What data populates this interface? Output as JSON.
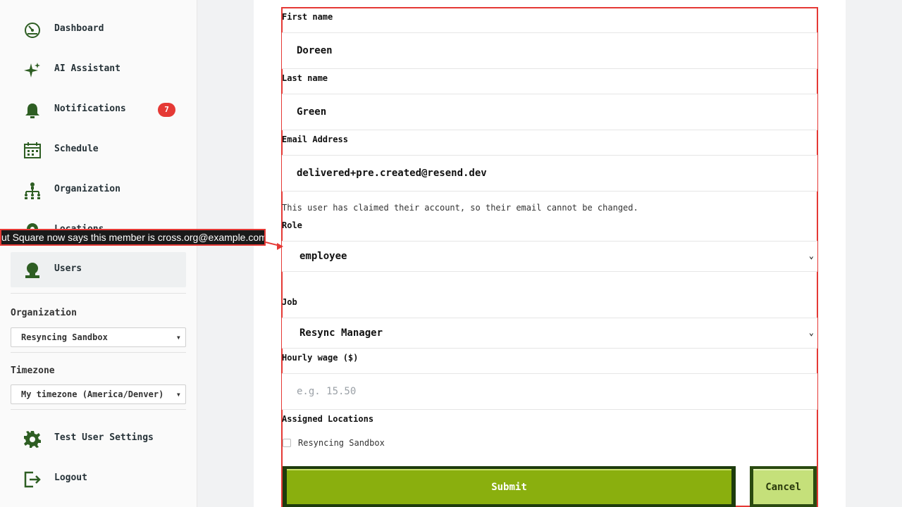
{
  "sidebar": {
    "items": [
      {
        "label": "Dashboard",
        "icon": "dashboard-icon"
      },
      {
        "label": "AI Assistant",
        "icon": "sparkle-icon"
      },
      {
        "label": "Notifications",
        "icon": "bell-icon",
        "badge": "7"
      },
      {
        "label": "Schedule",
        "icon": "calendar-icon"
      },
      {
        "label": "Organization",
        "icon": "org-chart-icon"
      },
      {
        "label": "Locations",
        "icon": "location-icon"
      },
      {
        "label": "Users",
        "icon": "user-icon",
        "active": true
      },
      {
        "label": "Test User Settings",
        "icon": "gear-icon"
      },
      {
        "label": "Logout",
        "icon": "logout-icon"
      }
    ],
    "organization": {
      "label": "Organization",
      "value": "Resyncing Sandbox"
    },
    "timezone": {
      "label": "Timezone",
      "value": "My timezone (America/Denver)"
    }
  },
  "form": {
    "first_name": {
      "label": "First name",
      "value": "Doreen"
    },
    "last_name": {
      "label": "Last name",
      "value": "Green"
    },
    "email": {
      "label": "Email Address",
      "value": "delivered+pre.created@resend.dev"
    },
    "email_note": "This user has claimed their account, so their email cannot be changed.",
    "role": {
      "label": "Role",
      "value": "employee"
    },
    "job": {
      "label": "Job",
      "value": "Resync Manager"
    },
    "wage": {
      "label": "Hourly wage ($)",
      "placeholder": "e.g. 15.50"
    },
    "locations": {
      "label": "Assigned Locations",
      "options": [
        "Resyncing Sandbox"
      ]
    },
    "submit_label": "Submit",
    "cancel_label": "Cancel"
  },
  "banner": {
    "text": "ut Square now says this member is cross.org@example.com"
  },
  "colors": {
    "accent": "#8aaf0e",
    "accent_dark": "#1d3b0d",
    "cancel": "#c5e07a",
    "badge": "#e53935",
    "highlight": "#e53935",
    "icon": "#2e5e23"
  }
}
